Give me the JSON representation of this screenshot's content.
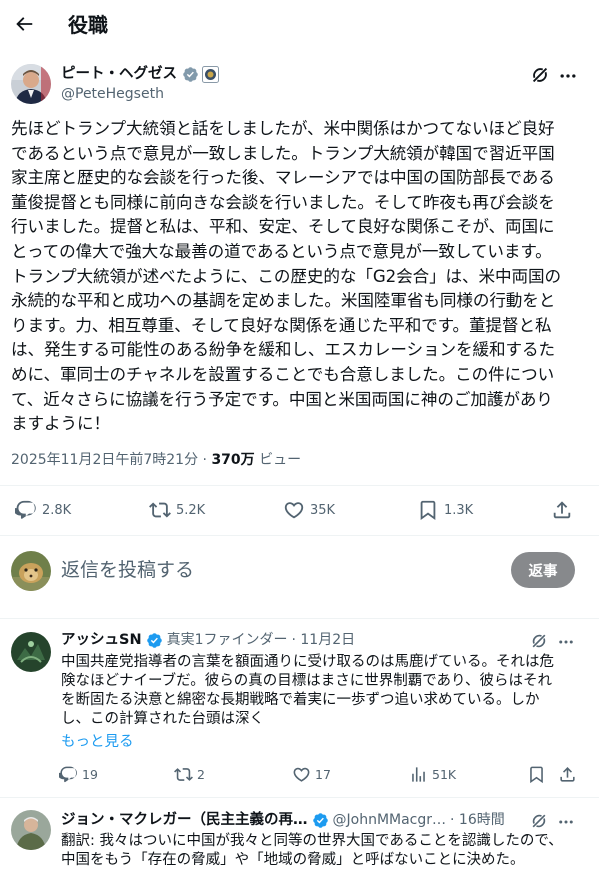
{
  "header": {
    "title": "役職"
  },
  "tweet": {
    "author_name": "ピート・ヘグゼス",
    "author_handle": "@PeteHegseth",
    "text": "先ほどトランプ大統領と話をしましたが、米中関係はかつてないほど良好\nであるという点で意見が一致しました。トランプ大統領が韓国で習近平国\n家主席と歴史的な会談を行った後、マレーシアでは中国の国防部長である\n董俊提督とも同様に前向きな会談を行いました。そして昨夜も再び会談を\n行いました。提督と私は、平和、安定、そして良好な関係こそが、両国に\nとっての偉大で強大な最善の道であるという点で意見が一致しています。\nトランプ大統領が述べたように、この歴史的な「G2会合」は、米中両国の\n永続的な平和と成功への基調を定めました。米国陸軍省も同様の行動をと\nります。力、相互尊重、そして良好な関係を通じた平和です。董提督と私\nは、発生する可能性のある紛争を緩和し、エスカレーションを緩和するた\nめに、軍同士のチャネルを設置することでも合意しました。この件につい\nて、近々さらに協議を行う予定です。中国と米国両国に神のご加護があり\nますように！",
    "timestamp": "2025年11月2日午前7時21分",
    "separator": "·",
    "views_count": "370万",
    "views_label": "ビュー",
    "stats": {
      "replies": "2.8K",
      "reposts": "5.2K",
      "likes": "35K",
      "bookmarks": "1.3K"
    }
  },
  "composer": {
    "placeholder": "返信を投稿する",
    "reply_button": "返事"
  },
  "replies": [
    {
      "author_name": "アッシュSN",
      "badge_text": "真実1ファインダー",
      "time": "· 11月2日",
      "text": "中国共産党指導者の言葉を額面通りに受け取るのは馬鹿げている。それは危\n険なほどナイーブだ。彼らの真の目標はまさに世界制覇であり、彼らはそれ\nを断固たる決意と綿密な長期戦略で着実に一歩ずつ追い求めている。しか\nし、この計算された台頭は深く",
      "show_more": "もっと見る",
      "stats": {
        "replies": "19",
        "reposts": "2",
        "likes": "17",
        "views": "51K"
      }
    },
    {
      "author_name": "ジョン・マクレガー（民主主義の再…",
      "handle": "@JohnMMacgr…",
      "time": "· 16時間",
      "text": "翻訳: 我々はついに中国が我々と同等の世界大国であることを認識したので、\n中国をもう「存在の脅威」や「地域の脅威」と呼ばないことに決めた。"
    }
  ],
  "colors": {
    "text": "#0f1419",
    "secondary": "#536471",
    "link": "#1d9bf0",
    "verified": "#1d9bf0",
    "divider": "#eff3f4",
    "reply_button_bg": "#87898c"
  }
}
